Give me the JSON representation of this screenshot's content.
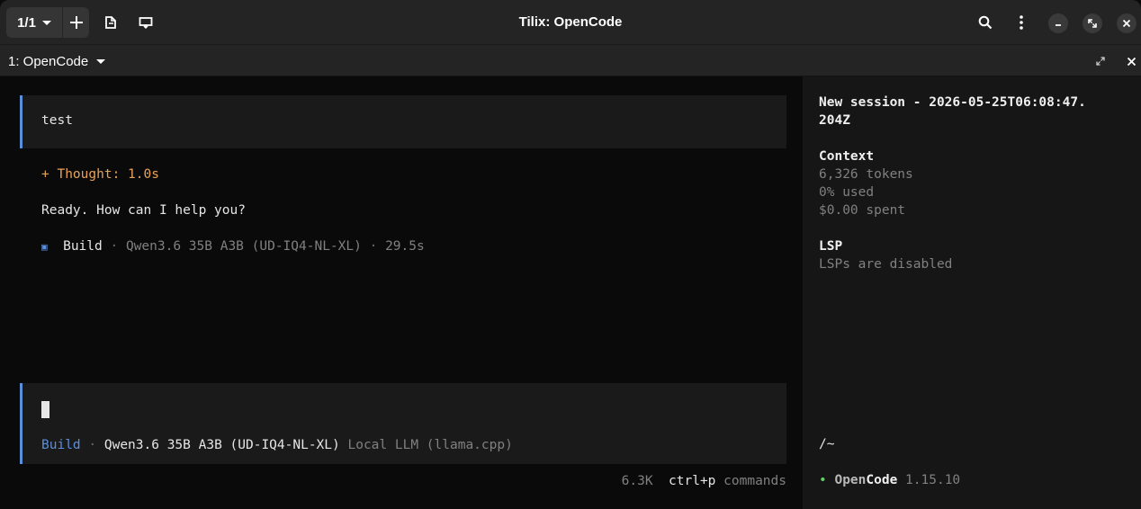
{
  "header": {
    "session_counter": "1/1",
    "title": "Tilix: OpenCode"
  },
  "tab": {
    "title": "1: OpenCode"
  },
  "chat": {
    "user_message": "test",
    "thought_label": "+ Thought: 1.0s",
    "assistant_reply": "Ready. How can I help you?",
    "build_marker": "▣",
    "build_label": "Build",
    "build_sep1": " · ",
    "build_model": "Qwen3.6 35B A3B (UD-IQ4-NL-XL)",
    "build_sep2": " · ",
    "build_duration": "29.5s"
  },
  "prompt": {
    "mode": "Build",
    "sep": " · ",
    "model": "Qwen3.6 35B A3B (UD-IQ4-NL-XL)",
    "provider": " Local LLM (llama.cpp)"
  },
  "footer": {
    "tokens": "6.3K",
    "shortcut": "ctrl+p",
    "shortcut_label": " commands"
  },
  "sidebar": {
    "session_title_line1": "New session - 2026-05-25T06:08:47.",
    "session_title_line2": "204Z",
    "context_heading": "Context",
    "context_tokens": "6,326 tokens",
    "context_used": "0% used",
    "context_spent": "$0.00 spent",
    "lsp_heading": "LSP",
    "lsp_status": "LSPs are disabled",
    "cwd": "/~",
    "status_dot": "•",
    "app_name_prefix": "Open",
    "app_name_suffix": "Code",
    "version": "1.15.10"
  },
  "colors": {
    "accent_blue": "#5b8fd9",
    "thought_orange": "#e8a25a",
    "muted": "#808080",
    "status_green": "#5fd35f"
  }
}
